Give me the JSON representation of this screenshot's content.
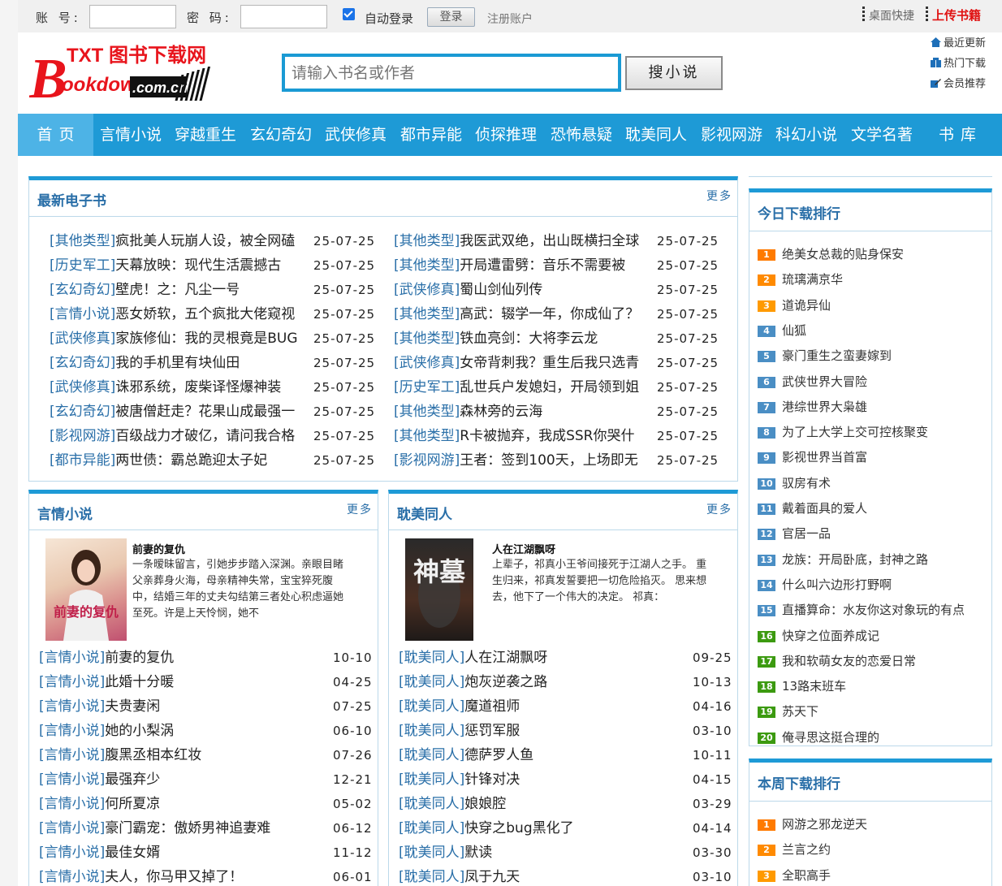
{
  "topbar": {
    "account_label": "账 号:",
    "password_label": "密 码:",
    "account_value": "",
    "password_value": "",
    "auto_login_label": "自动登录",
    "login_button": "登录",
    "register_link": "注册账户",
    "desktop_shortcut": "桌面快捷",
    "upload_books": "上传书籍"
  },
  "logo": {
    "top_text": "TXT 图书下载网",
    "brand": "ookdown",
    "domain": ".com.cn",
    "initial": "B"
  },
  "search": {
    "placeholder": "请输入书名或作者",
    "button": "搜小说"
  },
  "quick_links": [
    "最近更新",
    "热门下载",
    "会员推荐"
  ],
  "nav": {
    "home": "首页",
    "items": [
      "言情小说",
      "穿越重生",
      "玄幻奇幻",
      "武侠修真",
      "都市异能",
      "侦探推理",
      "恐怖悬疑",
      "耽美同人",
      "影视网游",
      "科幻小说",
      "文学名著"
    ],
    "library": "书库"
  },
  "latest": {
    "title": "最新电子书",
    "more": "更多",
    "left": [
      {
        "cat": "[其他类型]",
        "name": "疯批美人玩崩人设，被全网磕",
        "date": "25-07-25"
      },
      {
        "cat": "[历史军工]",
        "name": "天幕放映：现代生活震撼古",
        "date": "25-07-25"
      },
      {
        "cat": "[玄幻奇幻]",
        "name": "壁虎！之：凡尘一号",
        "date": "25-07-25"
      },
      {
        "cat": "[言情小说]",
        "name": "恶女娇软，五个疯批大佬窥视",
        "date": "25-07-25"
      },
      {
        "cat": "[武侠修真]",
        "name": "家族修仙：我的灵根竟是BUG",
        "date": "25-07-25"
      },
      {
        "cat": "[玄幻奇幻]",
        "name": "我的手机里有块仙田",
        "date": "25-07-25"
      },
      {
        "cat": "[武侠修真]",
        "name": "诛邪系统，废柴译怪爆神装",
        "date": "25-07-25"
      },
      {
        "cat": "[玄幻奇幻]",
        "name": "被唐僧赶走？花果山成最强一",
        "date": "25-07-25"
      },
      {
        "cat": "[影视网游]",
        "name": "百级战力才破亿，请问我合格",
        "date": "25-07-25"
      },
      {
        "cat": "[都市异能]",
        "name": "两世债：霸总跪迎太子妃",
        "date": "25-07-25"
      }
    ],
    "right": [
      {
        "cat": "[其他类型]",
        "name": "我医武双绝，出山既横扫全球",
        "date": "25-07-25"
      },
      {
        "cat": "[其他类型]",
        "name": "开局遭雷劈：音乐不需要被",
        "date": "25-07-25"
      },
      {
        "cat": "[武侠修真]",
        "name": "蜀山剑仙列传",
        "date": "25-07-25"
      },
      {
        "cat": "[其他类型]",
        "name": "高武：辍学一年，你成仙了？",
        "date": "25-07-25"
      },
      {
        "cat": "[其他类型]",
        "name": "铁血亮剑：大将李云龙",
        "date": "25-07-25"
      },
      {
        "cat": "[武侠修真]",
        "name": "女帝背刺我？重生后我只选青",
        "date": "25-07-25"
      },
      {
        "cat": "[历史军工]",
        "name": "乱世兵户发媳妇，开局领到姐",
        "date": "25-07-25"
      },
      {
        "cat": "[其他类型]",
        "name": "森林旁的云海",
        "date": "25-07-25"
      },
      {
        "cat": "[其他类型]",
        "name": "R卡被抛弃，我成SSR你哭什",
        "date": "25-07-25"
      },
      {
        "cat": "[影视网游]",
        "name": "王者：签到100天，上场即无",
        "date": "25-07-25"
      }
    ]
  },
  "romance": {
    "title": "言情小说",
    "more": "更多",
    "feature": {
      "title": "前妻的复仇",
      "cover_text": "前妻的复仇",
      "desc": "一条暧昧留言，引她步步踏入深渊。亲眼目睹父亲葬身火海，母亲精神失常，宝宝猝死腹中，结婚三年的丈夫勾结第三者处心积虑逼她至死。许是上天怜悯，她不"
    },
    "rows": [
      {
        "cat": "[言情小说]",
        "name": "前妻的复仇",
        "date": "10-10"
      },
      {
        "cat": "[言情小说]",
        "name": "此婚十分暖",
        "date": "04-25"
      },
      {
        "cat": "[言情小说]",
        "name": "夫贵妻闲",
        "date": "07-25"
      },
      {
        "cat": "[言情小说]",
        "name": "她的小梨涡",
        "date": "06-10"
      },
      {
        "cat": "[言情小说]",
        "name": "腹黑丞相本红妆",
        "date": "07-26"
      },
      {
        "cat": "[言情小说]",
        "name": "最强弃少",
        "date": "12-21"
      },
      {
        "cat": "[言情小说]",
        "name": "何所夏凉",
        "date": "05-02"
      },
      {
        "cat": "[言情小说]",
        "name": "豪门霸宠：傲娇男神追妻难",
        "date": "06-12"
      },
      {
        "cat": "[言情小说]",
        "name": "最佳女婿",
        "date": "11-12"
      },
      {
        "cat": "[言情小说]",
        "name": "夫人，你马甲又掉了！",
        "date": "06-01"
      }
    ]
  },
  "danmei": {
    "title": "耽美同人",
    "more": "更多",
    "feature": {
      "title": "人在江湖飘呀",
      "cover_text": "神墓",
      "desc": "上辈子，祁真小王爷间接死于江湖人之手。 重生归来，祁真发誓要把一切危险掐灭。 思来想去，他下了一个伟大的决定。 祁真："
    },
    "rows": [
      {
        "cat": "[耽美同人]",
        "name": "人在江湖飘呀",
        "date": "09-25"
      },
      {
        "cat": "[耽美同人]",
        "name": "炮灰逆袭之路",
        "date": "10-13"
      },
      {
        "cat": "[耽美同人]",
        "name": "魔道祖师",
        "date": "04-16"
      },
      {
        "cat": "[耽美同人]",
        "name": "惩罚军服",
        "date": "03-10"
      },
      {
        "cat": "[耽美同人]",
        "name": "德萨罗人鱼",
        "date": "10-11"
      },
      {
        "cat": "[耽美同人]",
        "name": "针锋对决",
        "date": "04-15"
      },
      {
        "cat": "[耽美同人]",
        "name": "娘娘腔",
        "date": "03-29"
      },
      {
        "cat": "[耽美同人]",
        "name": "快穿之bug黑化了",
        "date": "04-14"
      },
      {
        "cat": "[耽美同人]",
        "name": "默读",
        "date": "03-30"
      },
      {
        "cat": "[耽美同人]",
        "name": "凤于九天",
        "date": "03-10"
      }
    ]
  },
  "today_rank": {
    "title": "今日下载排行",
    "items": [
      "绝美女总裁的贴身保安",
      "琉璃满京华",
      "道诡异仙",
      "仙狐",
      "豪门重生之蛮妻嫁到",
      "武侠世界大冒险",
      "港综世界大枭雄",
      "为了上大学上交可控核聚变",
      "影视世界当首富",
      "驭房有术",
      "戴着面具的爱人",
      "官居一品",
      "龙族：开局卧底，封神之路",
      "什么叫六边形打野啊",
      "直播算命：水友你这对象玩的有点",
      "快穿之位面养成记",
      "我和软萌女友的恋爱日常",
      "13路末班车",
      "苏天下",
      "俺寻思这挺合理的"
    ]
  },
  "week_rank": {
    "title": "本周下载排行",
    "items": [
      "网游之邪龙逆天",
      "兰言之约",
      "全职高手"
    ]
  },
  "colors": {
    "accent": "#1e9ad6",
    "link": "#2a6fa8",
    "upload": "#e01010"
  }
}
